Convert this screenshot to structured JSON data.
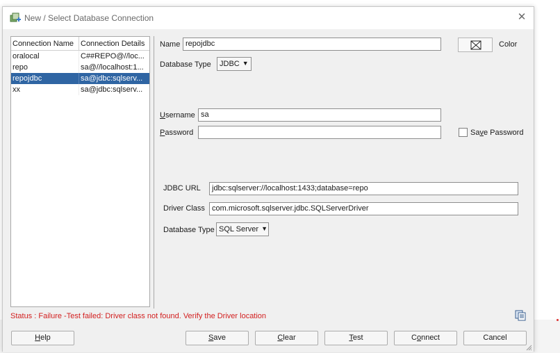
{
  "dialog": {
    "title": "New / Select Database Connection",
    "close_glyph": "✕"
  },
  "connections": {
    "headers": [
      "Connection Name",
      "Connection Details"
    ],
    "rows": [
      {
        "name": "oralocal",
        "details": "C##REPO@//loc..."
      },
      {
        "name": "repo",
        "details": "sa@//localhost:1..."
      },
      {
        "name": "repojdbc",
        "details": "sa@jdbc:sqlserv..."
      },
      {
        "name": "xx",
        "details": "sa@jdbc:sqlserv..."
      }
    ],
    "selected_index": 2
  },
  "form": {
    "name_label": "Name",
    "name_value": "repojdbc",
    "color_label": "Color",
    "database_type_label": "Database Type",
    "database_type_value": "JDBC",
    "username_label": "Username",
    "username_value": "sa",
    "password_label": "Password",
    "password_value": "",
    "save_password_label": "Save Password",
    "save_password_checked": false
  },
  "jdbc": {
    "url_label": "JDBC URL",
    "url_value": "jdbc:sqlserver://localhost:1433;database=repo",
    "driver_label": "Driver Class",
    "driver_value": "com.microsoft.sqlserver.jdbc.SQLServerDriver",
    "db_type_label": "Database Type",
    "db_type_value": "SQL Server"
  },
  "status": {
    "text": "Status : Failure -Test failed: Driver class not found. Verify the Driver location",
    "color": "#d21e1e"
  },
  "buttons": {
    "help": "Help",
    "save": "Save",
    "clear": "Clear",
    "test": "Test",
    "connect": "Connect",
    "cancel": "Cancel"
  },
  "icons": {
    "title": "db-connection-icon",
    "color_button": "color-swatch-icon",
    "copy": "copy-icon",
    "dropdown": "▼"
  },
  "colors": {
    "selection": "#2f65a3",
    "status_error": "#d21e1e"
  }
}
